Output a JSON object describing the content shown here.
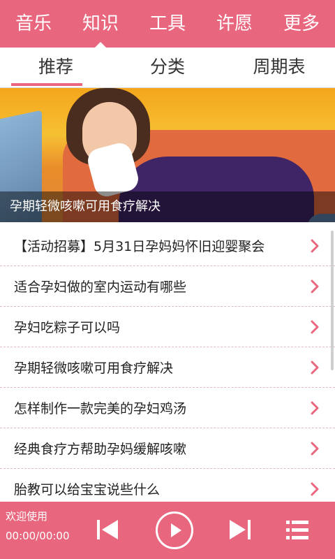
{
  "top_nav": {
    "tabs": [
      {
        "label": "音乐",
        "active": false
      },
      {
        "label": "知识",
        "active": true
      },
      {
        "label": "工具",
        "active": false
      },
      {
        "label": "许愿",
        "active": false
      },
      {
        "label": "更多",
        "active": false
      }
    ]
  },
  "sub_tabs": [
    {
      "label": "推荐",
      "active": true
    },
    {
      "label": "分类",
      "active": false
    },
    {
      "label": "周期表",
      "active": false
    }
  ],
  "banner": {
    "caption": "孕期轻微咳嗽可用食疗解决"
  },
  "articles": [
    "【活动招募】5月31日孕妈妈怀旧迎婴聚会",
    "适合孕妇做的室内运动有哪些",
    "孕妇吃粽子可以吗",
    "孕期轻微咳嗽可用食疗解决",
    "怎样制作一款完美的孕妇鸡汤",
    "经典食疗方帮助孕妈缓解咳嗽",
    "胎教可以给宝宝说些什么"
  ],
  "player": {
    "welcome": "欢迎使用",
    "time": "00:00/00:00",
    "icons": [
      "previous-icon",
      "play-icon",
      "next-icon",
      "playlist-icon"
    ]
  },
  "colors": {
    "accent": "#e8677f"
  }
}
